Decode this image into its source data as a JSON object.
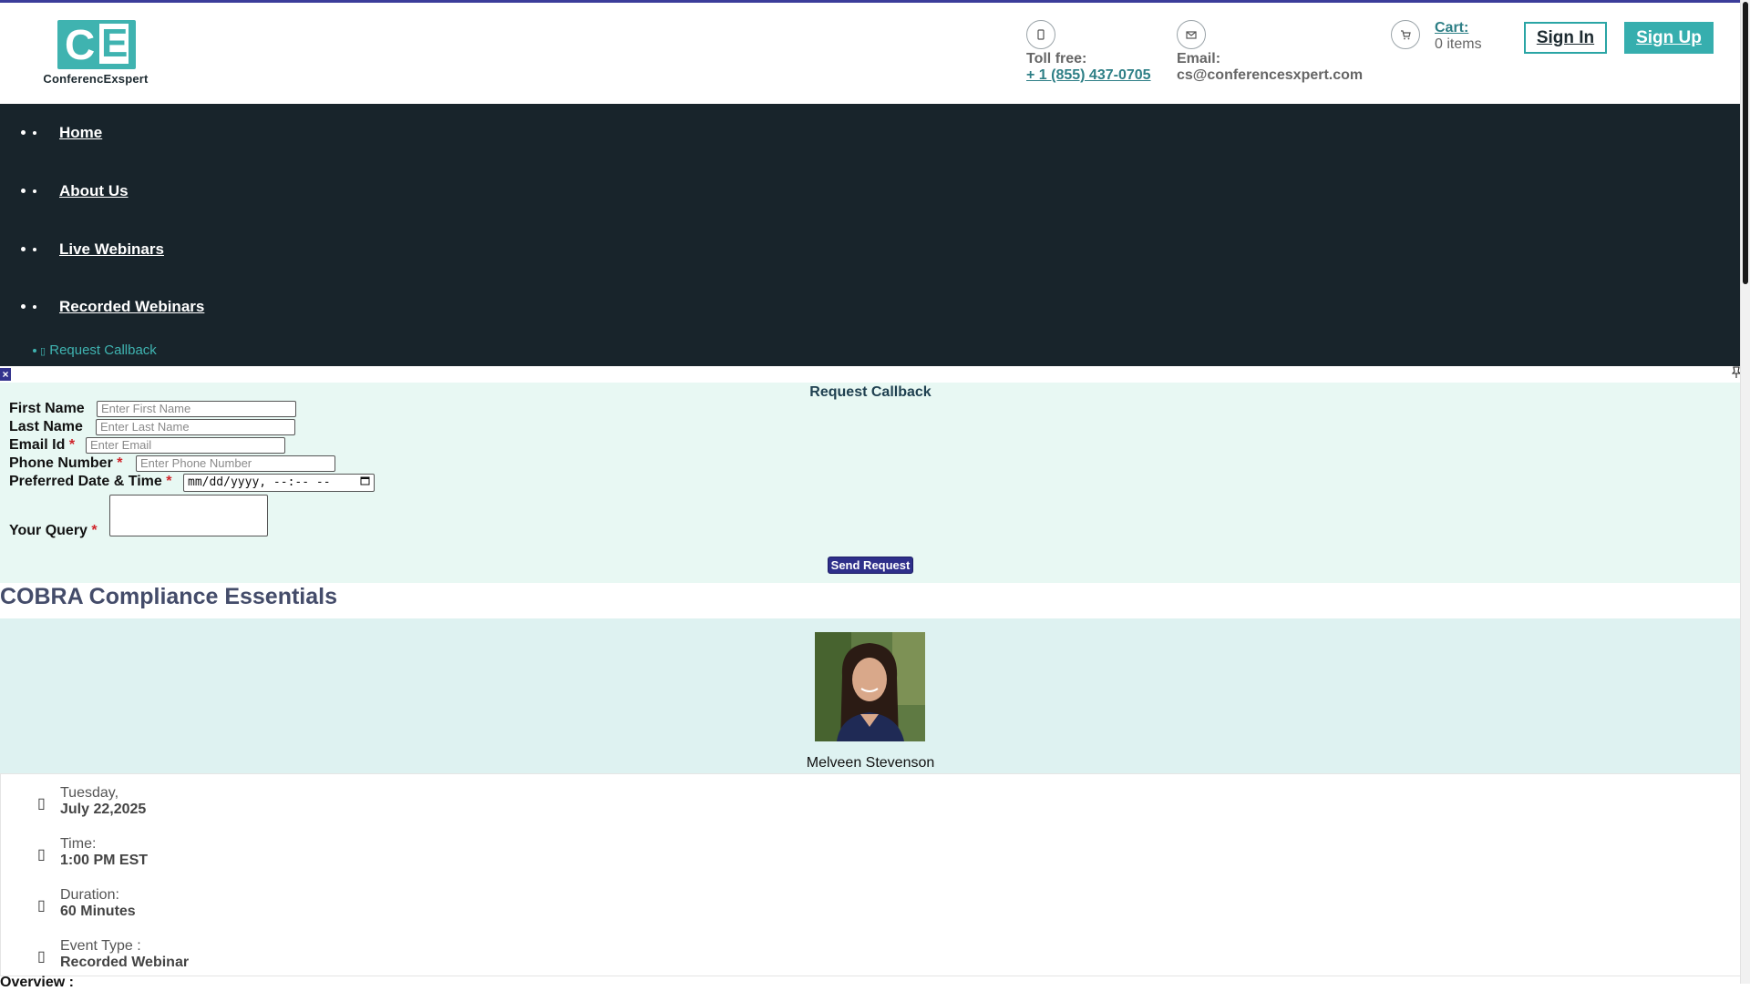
{
  "header": {
    "logo_text": "ConferencExspert",
    "toll_free_label": "Toll free:",
    "toll_free_value": "+ 1 (855) 437-0705",
    "email_label": "Email:",
    "email_value": "cs@conferencesxpert.com",
    "cart_label": "Cart",
    "cart_items": "0 items",
    "sign_in": "Sign In",
    "sign_up": "Sign Up",
    "phone_icon": "phone-icon",
    "mail_icon": "envelope-icon",
    "cart_icon": "cart-icon"
  },
  "nav": {
    "items": [
      {
        "label": "Home"
      },
      {
        "label": "About Us"
      },
      {
        "label": "Live Webinars"
      },
      {
        "label": "Recorded Webinars"
      }
    ],
    "callback_label": "Request Callback"
  },
  "callback_form": {
    "close_label": "×",
    "title": "Request Callback",
    "first_name_label": "First Name",
    "first_name_placeholder": "Enter First Name",
    "last_name_label": "Last Name",
    "last_name_placeholder": "Enter Last Name",
    "email_label": "Email Id",
    "email_placeholder": "Enter Email",
    "phone_label": "Phone Number",
    "phone_placeholder": "Enter Phone Number",
    "datetime_label": "Preferred Date & Time",
    "datetime_value": "mm/dd/yyyy, --:-- --",
    "query_label": "Your Query",
    "required_mark": "*",
    "send_button": "Send Request"
  },
  "course": {
    "title": "COBRA Compliance Essentials",
    "speaker_name": "Melveen Stevenson",
    "details": [
      {
        "label": "Tuesday,",
        "value": "July 22,2025",
        "icon": "calendar-icon"
      },
      {
        "label": "Time:",
        "value": "1:00 PM EST",
        "icon": "clock-icon"
      },
      {
        "label": "Duration:",
        "value": "60 Minutes",
        "icon": "hourglass-icon"
      },
      {
        "label": "Event Type :",
        "value": "Recorded Webinar",
        "icon": "video-icon"
      }
    ],
    "overview_label": "Overview :"
  },
  "colors": {
    "nav_bg": "#18242b",
    "accent": "#36aeae",
    "form_bg": "#e8f8f3",
    "speaker_bg": "#def2f1",
    "button_blue": "#2e2f8a"
  }
}
